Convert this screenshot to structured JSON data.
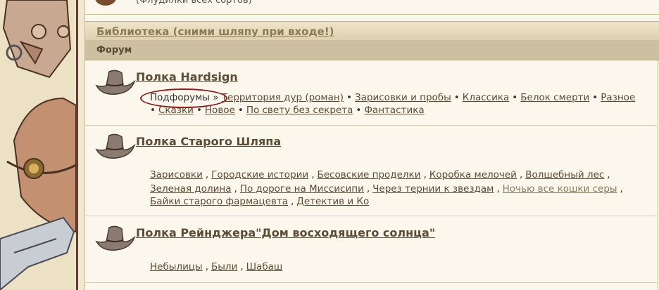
{
  "top": {
    "description": "(Флудилки всех сортов)"
  },
  "section": {
    "link": "Библиотека (сними шляпу при входе!)"
  },
  "category": {
    "title": "Форум"
  },
  "forums": [
    {
      "title": "Полка Hardsign",
      "subforums_label": "Подфорумы »",
      "lines": [
        [
          "Территория дур (роман)",
          "Зарисовки и пробы",
          "Классика",
          "Белок смерти",
          "Разное"
        ],
        [
          "Сказки",
          "Новое",
          "По свету без секрета",
          "Фантастика"
        ]
      ]
    },
    {
      "title": "Полка Старого Шляпа",
      "lines": [
        [
          "Зарисовки",
          "Городские истории",
          "Бесовские проделки",
          "Коробка мелочей",
          "Волшебный лес"
        ],
        [
          "Зеленая долина",
          "По дороге на Миссисипи",
          "Через тернии к звездам",
          "Ночью все кошки серы"
        ],
        [
          "Байки старого фармацевта",
          "Детектив и Ко"
        ]
      ]
    },
    {
      "title": "Полка Рейнджера\"Дом восходящего солнца\"",
      "lines": [
        [
          "Небылицы",
          "Были",
          "Шабаш"
        ]
      ]
    }
  ],
  "colors": {
    "accent": "#5c4d38",
    "oval": "#8a1c1c",
    "header_bg": "#cdc0a0"
  }
}
